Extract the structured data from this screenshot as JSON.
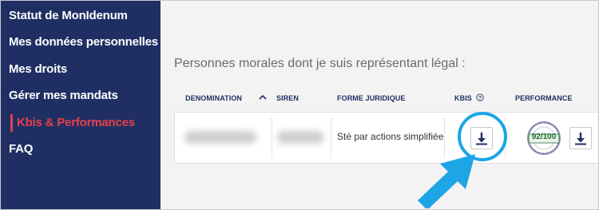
{
  "sidebar": {
    "items": [
      {
        "label": "Statut de MonIdenum"
      },
      {
        "label": "Mes données personnelles"
      },
      {
        "label": "Mes droits"
      },
      {
        "label": "Gérer mes mandats"
      },
      {
        "label": "Kbis & Performances",
        "active": true
      },
      {
        "label": "FAQ"
      }
    ]
  },
  "main": {
    "title": "Personnes morales dont je suis représentant légal :",
    "table": {
      "headers": {
        "denomination": "DENOMINATION",
        "siren": "SIREN",
        "forme": "FORME JURIDIQUE",
        "kbis": "KBIS",
        "performance": "PERFORMANCE"
      },
      "rows": [
        {
          "forme_juridique": "Sté par actions simplifiée",
          "performance_score": "92/100"
        }
      ]
    }
  },
  "colors": {
    "sidebar_bg": "#1f2f63",
    "active": "#e6404a",
    "highlight": "#1ea5e6",
    "badge_green": "#1d6d2a"
  },
  "icons": {
    "sort": "chevron-up-icon",
    "help": "question-circle-icon",
    "download": "download-icon",
    "badge": "performance-seal-icon",
    "pointer": "arrow-icon"
  }
}
